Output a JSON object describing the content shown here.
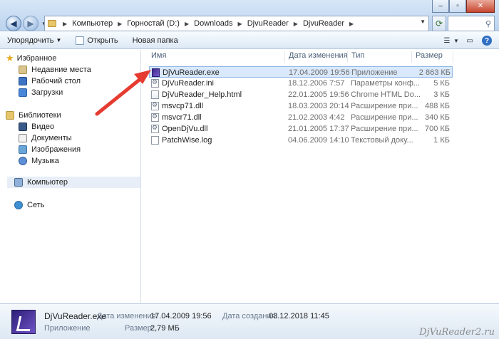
{
  "window": {
    "controls": [
      "minimize",
      "maximize",
      "close"
    ]
  },
  "address": {
    "crumbs": [
      "Компьютер",
      "Горностай (D:)",
      "Downloads",
      "DjvuReader",
      "DjvuReader"
    ]
  },
  "toolbar": {
    "organize_label": "Упорядочить",
    "open_label": "Открыть",
    "new_folder_label": "Новая папка"
  },
  "nav": {
    "favorites": "Избранное",
    "recent": "Недавние места",
    "desktop": "Рабочий стол",
    "downloads": "Загрузки",
    "libraries": "Библиотеки",
    "video": "Видео",
    "documents": "Документы",
    "images": "Изображения",
    "music": "Музыка",
    "computer": "Компьютер",
    "network": "Сеть"
  },
  "columns": {
    "name": "Имя",
    "date": "Дата изменения",
    "type": "Тип",
    "size": "Размер"
  },
  "files": [
    {
      "name": "DjVuReader.exe",
      "date": "17.04.2009 19:56",
      "type": "Приложение",
      "size": "2 863 КБ",
      "icon": "exe-icon"
    },
    {
      "name": "DjVuReader.ini",
      "date": "18.12.2006 7:57",
      "type": "Параметры конф...",
      "size": "5 КБ",
      "icon": "ini-icon"
    },
    {
      "name": "DjVuReader_Help.html",
      "date": "22.01.2005 19:56",
      "type": "Chrome HTML Do...",
      "size": "3 КБ",
      "icon": "html-icon"
    },
    {
      "name": "msvcp71.dll",
      "date": "18.03.2003 20:14",
      "type": "Расширение при...",
      "size": "488 КБ",
      "icon": "dll-icon"
    },
    {
      "name": "msvcr71.dll",
      "date": "21.02.2003 4:42",
      "type": "Расширение при...",
      "size": "340 КБ",
      "icon": "dll-icon"
    },
    {
      "name": "OpenDjVu.dll",
      "date": "21.01.2005 17:37",
      "type": "Расширение при...",
      "size": "700 КБ",
      "icon": "dll-icon"
    },
    {
      "name": "PatchWise.log",
      "date": "04.06.2009 14:10",
      "type": "Текстовый доку...",
      "size": "1 КБ",
      "icon": "log-icon"
    }
  ],
  "details": {
    "filename": "DjVuReader.exe",
    "kind": "Приложение",
    "modified_label": "Дата изменения:",
    "modified_value": "17.04.2009 19:56",
    "size_label": "Размер:",
    "size_value": "2,79 МБ",
    "created_label": "Дата создания:",
    "created_value": "03.12.2018 11:45"
  },
  "watermark": "DjVuReader2.ru",
  "colors": {
    "selection": "#d9e8fa",
    "arrow": "#e53b30"
  }
}
